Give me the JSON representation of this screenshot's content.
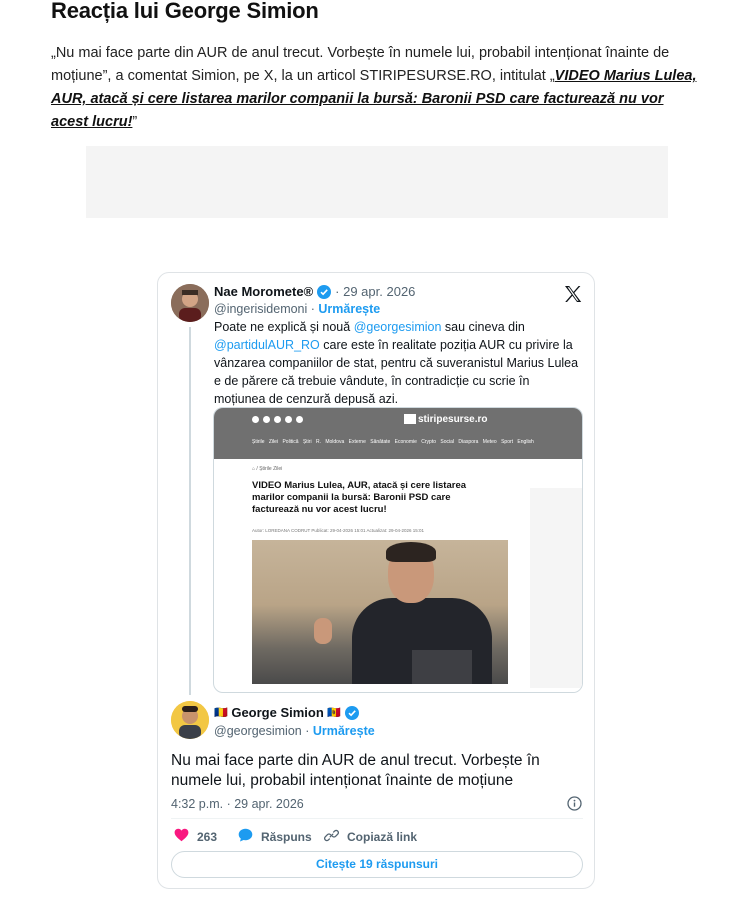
{
  "article": {
    "heading": "Reacția lui George Simion",
    "paragraph_text": "„Nu mai face parte din AUR de anul trecut. Vorbește în numele lui, probabil intenționat înainte de moțiune”, a comentat Simion, pe X, la un articol STIRIPESURSE.RO, intitulat „",
    "paragraph_link": "VIDEO Marius Lulea, AUR, atacă și cere listarea marilor companii la bursă: Baronii PSD care facturează nu vor acest lucru!",
    "paragraph_end": "”"
  },
  "tweet": {
    "original": {
      "name": "Nae Moromete®",
      "date": "· 29 apr. 2026",
      "handle": "@ingerisidemoni",
      "follow": "Urmărește",
      "text_1": "Poate ne explică și nouă ",
      "mention_1": "@georgesimion",
      "text_2": "  sau cineva din ",
      "mention_2": "@partidulAUR_RO",
      "text_3": "  care este în realitate poziția AUR cu privire la vânzarea companiilor de stat, pentru că suveranistul Marius Lulea e de părere că trebuie vândute, în contradicție cu scrie în moțiunea de cenzură depusă azi."
    },
    "screenshot": {
      "site_name": "stiripesurse.ro",
      "nav": "Știrile Zilei  Politică  Știri R. Moldova  Externe  Sănătate  Economie  Crypto  Social  Diaspora  Meteo  Sport  English",
      "breadcrumb": "⌂ / Știrile Zilei",
      "title": "VIDEO Marius Lulea, AUR, atacă și cere listarea marilor companii la bursă: Baronii PSD care facturează nu vor acest lucru!",
      "meta": "Autor: LOREDANA CODRUT   Publicat: 29-04-2026 15:01   Actualizat: 29-04-2026 15:01"
    },
    "reply": {
      "flag_ro": "🇷🇴",
      "name": "George Simion",
      "flag_md": "🇲🇩",
      "handle": "@georgesimion",
      "follow": "Urmărește",
      "text": "Nu mai face parte din AUR de anul trecut. Vorbește în numele lui, probabil intenționat înainte de moțiune",
      "time": "4:32 p.m. · 29 apr. 2026"
    },
    "actions": {
      "likes": "263",
      "reply_label": "Răspuns",
      "copy_label": "Copiază link"
    },
    "read_replies": "Citește 19 răspunsuri"
  },
  "colors": {
    "link_blue": "#1d9bf0",
    "like_red": "#f91880",
    "text_gray": "#536471"
  }
}
